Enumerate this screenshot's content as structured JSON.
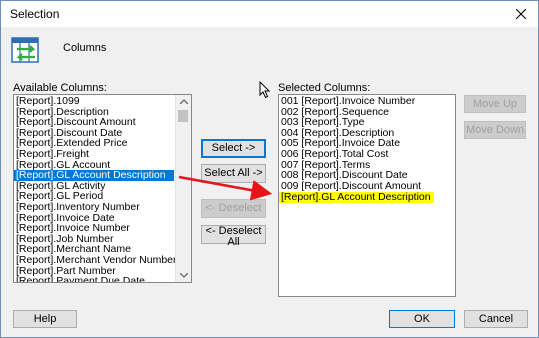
{
  "window": {
    "title": "Selection"
  },
  "header": {
    "label": "Columns"
  },
  "available": {
    "label": "Available Columns:",
    "items": [
      "[Report].1099",
      "[Report].Description",
      "[Report].Discount Amount",
      "[Report].Discount Date",
      "[Report].Extended Price",
      "[Report].Freight",
      "[Report].GL Account",
      "[Report].GL Account Description",
      "[Report].GL Activity",
      "[Report].GL Period",
      "[Report].Inventory Number",
      "[Report].Invoice Date",
      "[Report].Invoice Number",
      "[Report].Job Number",
      "[Report].Merchant Name",
      "[Report].Merchant Vendor Number",
      "[Report].Part Number",
      "[Report].Payment Due Date"
    ],
    "selected_index": 7
  },
  "selected": {
    "label": "Selected Columns:",
    "items": [
      "001 [Report].Invoice Number",
      "002 [Report].Sequence",
      "003 [Report].Type",
      "004 [Report].Description",
      "005 [Report].Invoice Date",
      "006 [Report].Total Cost",
      "007 [Report].Terms",
      "008 [Report].Discount Date",
      "009 [Report].Discount Amount",
      "[Report].GL Account Description"
    ],
    "highlight_index": 9
  },
  "buttons": {
    "select": "Select ->",
    "select_all": "Select All ->",
    "deselect": "<- Deselect",
    "deselect_all": "<- Deselect All",
    "move_up": "Move Up",
    "move_down": "Move Down",
    "help": "Help",
    "ok": "OK",
    "cancel": "Cancel"
  },
  "colors": {
    "selection": "#0078d7",
    "highlight": "#ffff00",
    "annotation_arrow": "#e8141b"
  }
}
